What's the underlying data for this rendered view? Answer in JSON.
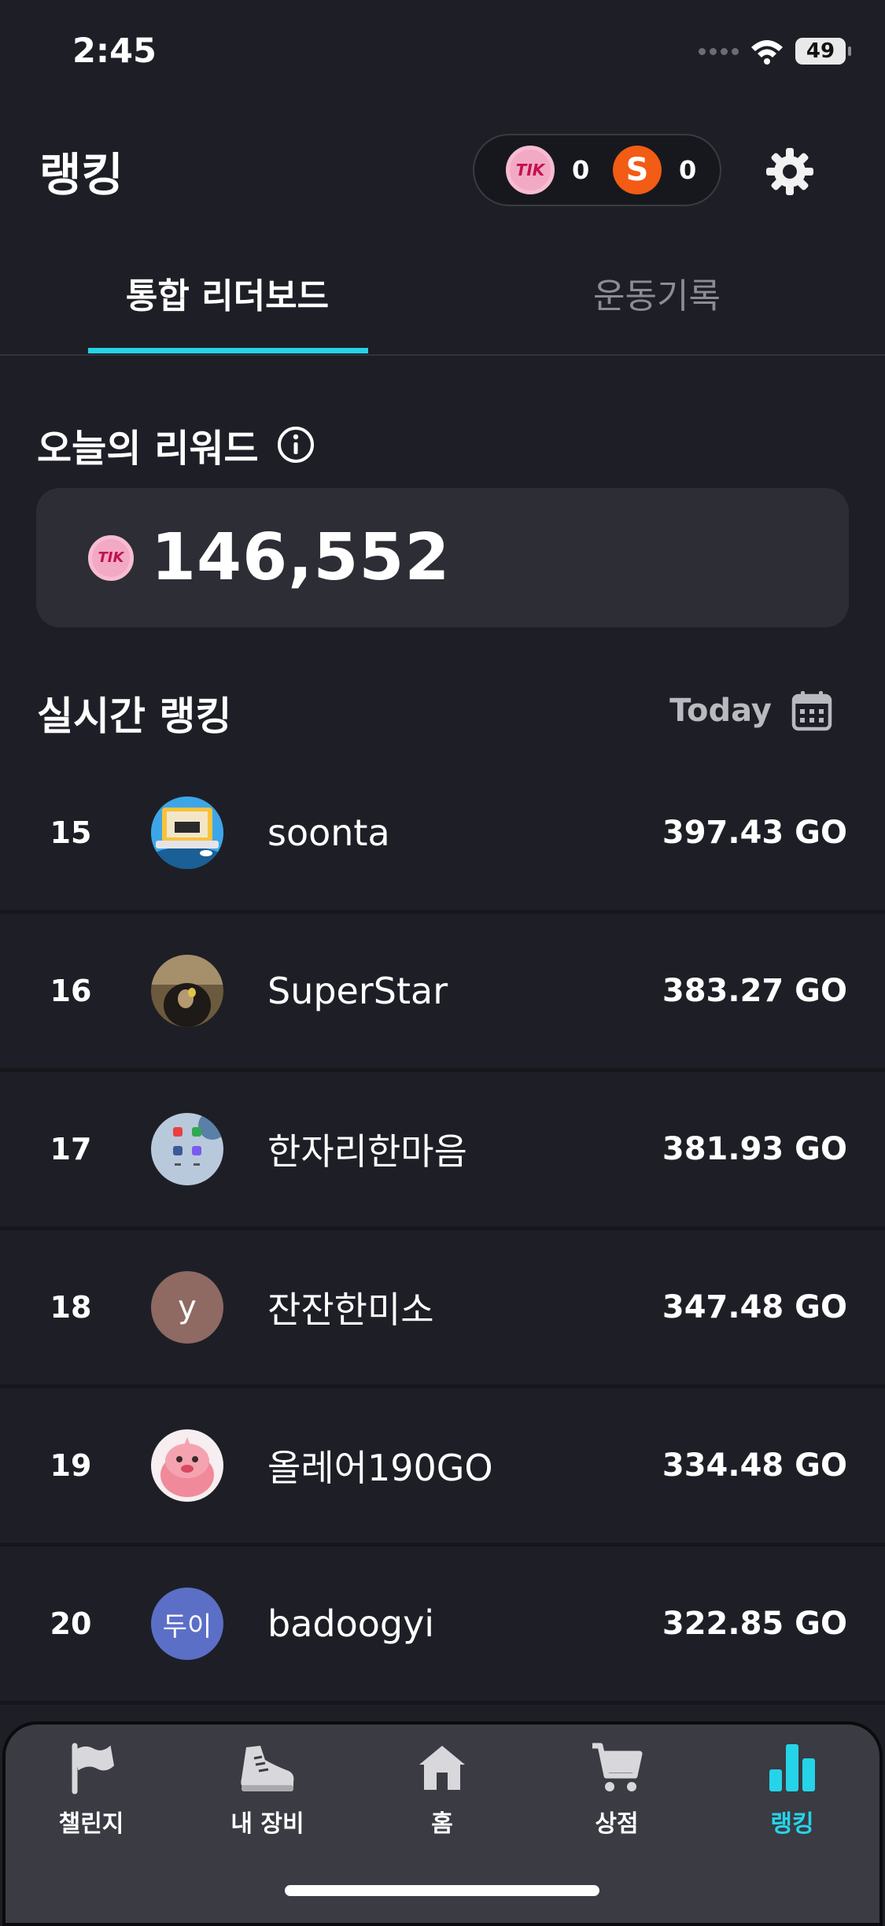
{
  "status_bar": {
    "time": "2:45",
    "battery": "49"
  },
  "header": {
    "title": "랭킹",
    "tik_count": "0",
    "tik_coin_label": "TIK",
    "s_coin_label": "S",
    "s_count": "0"
  },
  "tabs": [
    {
      "label": "통합 리더보드",
      "active": true
    },
    {
      "label": "운동기록",
      "active": false
    }
  ],
  "reward": {
    "title": "오늘의 리워드",
    "coin_label": "TIK",
    "value": "146,552"
  },
  "ranking": {
    "title": "실시간 랭킹",
    "date_filter": "Today",
    "rows": [
      {
        "rank": "15",
        "name": "soonta",
        "score": "397.43 GO",
        "avatar_icon": "laptop-avatar",
        "avatar_text": ""
      },
      {
        "rank": "16",
        "name": "SuperStar",
        "score": "383.27 GO",
        "avatar_icon": "photo-avatar",
        "avatar_text": ""
      },
      {
        "rank": "17",
        "name": "한자리한마음",
        "score": "381.93 GO",
        "avatar_icon": "apps-avatar",
        "avatar_text": ""
      },
      {
        "rank": "18",
        "name": "잔잔한미소",
        "score": "347.48 GO",
        "avatar_icon": "letter-avatar",
        "avatar_text": "y"
      },
      {
        "rank": "19",
        "name": "올레어190GO",
        "score": "334.48 GO",
        "avatar_icon": "character-avatar",
        "avatar_text": ""
      },
      {
        "rank": "20",
        "name": "badoogyi",
        "score": "322.85 GO",
        "avatar_icon": "text-avatar",
        "avatar_text": "두이"
      }
    ]
  },
  "nav": [
    {
      "label": "챌린지",
      "icon": "flag-icon",
      "active": false
    },
    {
      "label": "내 장비",
      "icon": "sneaker-icon",
      "active": false
    },
    {
      "label": "홈",
      "icon": "home-icon",
      "active": false
    },
    {
      "label": "상점",
      "icon": "cart-icon",
      "active": false
    },
    {
      "label": "랭킹",
      "icon": "bar-chart-icon",
      "active": true
    }
  ],
  "colors": {
    "background": "#1e1f26",
    "accent": "#25d4e8",
    "card": "#2c2d35",
    "nav_bg": "#3a3b43",
    "tik_coin": "#f2a9c3",
    "s_coin": "#f25c14"
  }
}
